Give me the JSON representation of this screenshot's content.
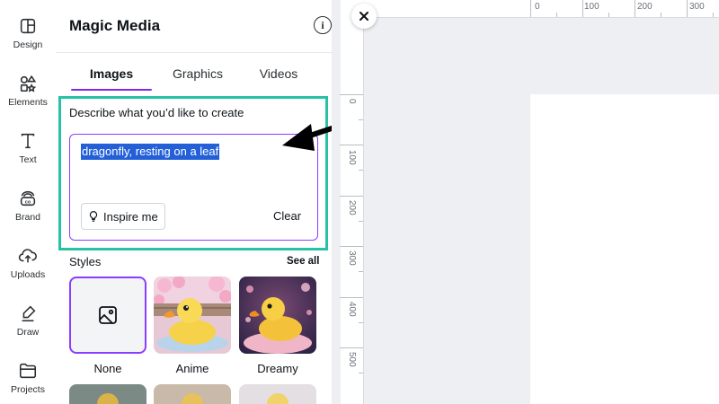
{
  "sidebar": {
    "items": [
      {
        "label": "Design",
        "icon": "design-icon"
      },
      {
        "label": "Elements",
        "icon": "elements-icon"
      },
      {
        "label": "Text",
        "icon": "text-icon"
      },
      {
        "label": "Brand",
        "icon": "brand-icon"
      },
      {
        "label": "Uploads",
        "icon": "uploads-icon"
      },
      {
        "label": "Draw",
        "icon": "draw-icon"
      },
      {
        "label": "Projects",
        "icon": "projects-icon"
      }
    ]
  },
  "panel": {
    "title": "Magic Media",
    "tabs": [
      {
        "label": "Images",
        "active": true
      },
      {
        "label": "Graphics",
        "active": false
      },
      {
        "label": "Videos",
        "active": false
      }
    ],
    "describe_label": "Describe what you’d like to create",
    "prompt_value": "dragonfly, resting on a leaf",
    "inspire_label": "Inspire me",
    "clear_label": "Clear",
    "styles_label": "Styles",
    "see_all_label": "See all",
    "styles": [
      {
        "name": "None",
        "selected": true
      },
      {
        "name": "Anime",
        "selected": false
      },
      {
        "name": "Dreamy",
        "selected": false
      }
    ]
  },
  "editor": {
    "ruler_top_labels": [
      "0",
      "100",
      "200",
      "300"
    ],
    "ruler_left_labels": [
      "0",
      "100",
      "200",
      "300",
      "400",
      "500"
    ]
  },
  "colors": {
    "accent": "#8b3dff",
    "highlight_frame": "#27c2a6",
    "selection": "#2360d8"
  }
}
